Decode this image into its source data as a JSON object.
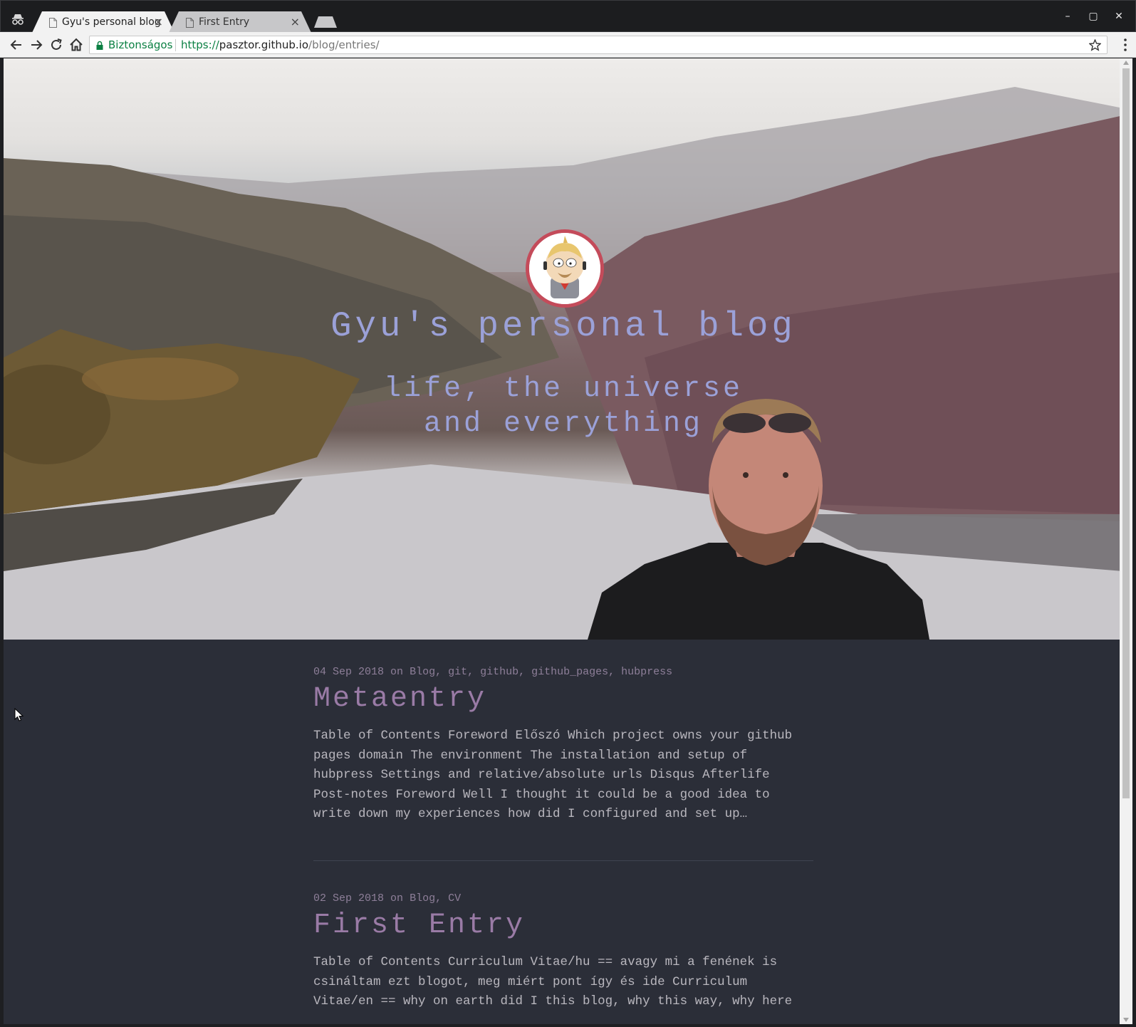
{
  "browser": {
    "tabs": [
      {
        "title": "Gyu's personal blog",
        "active": true
      },
      {
        "title": "First Entry",
        "active": false
      }
    ],
    "close_glyph": "×",
    "security_label": "Biztonságos",
    "url": {
      "scheme": "https://",
      "host": "pasztor.github.io",
      "path": "/blog/entries/"
    },
    "window_controls": {
      "minimize": "–",
      "maximize": "▢",
      "close": "✕"
    },
    "colors": {
      "secure": "#0b8043",
      "titlebar": "#1c1d1f",
      "toolbar": "#f2f2f2"
    }
  },
  "site": {
    "title": "Gyu's personal blog",
    "subtitle": "life, the universe and everything",
    "avatar_icon": "south-park-avatar-icon",
    "colors": {
      "title": "#9ba1d8",
      "background": "#2b2e38",
      "avatar_ring": "#c44b5a"
    }
  },
  "posts": [
    {
      "date": "04 Sep 2018",
      "on": "on",
      "tags": "Blog, git, github, github_pages, hubpress",
      "title": "Metaentry",
      "excerpt": "Table of Contents Foreword Előszó Which project owns your github pages domain The environment The installation and setup of hubpress Settings and relative/absolute urls Disqus Afterlife Post-notes Foreword Well I thought it could be a good idea to write down my experiences how did I configured and set up…"
    },
    {
      "date": "02 Sep 2018",
      "on": "on",
      "tags": "Blog, CV",
      "title": "First Entry",
      "excerpt": "Table of Contents Curriculum Vitae/hu == avagy mi a fenének is csináltam ezt blogot, meg miért pont így és ide Curriculum Vitae/en == why on earth did I this blog, why this way, why here"
    }
  ]
}
